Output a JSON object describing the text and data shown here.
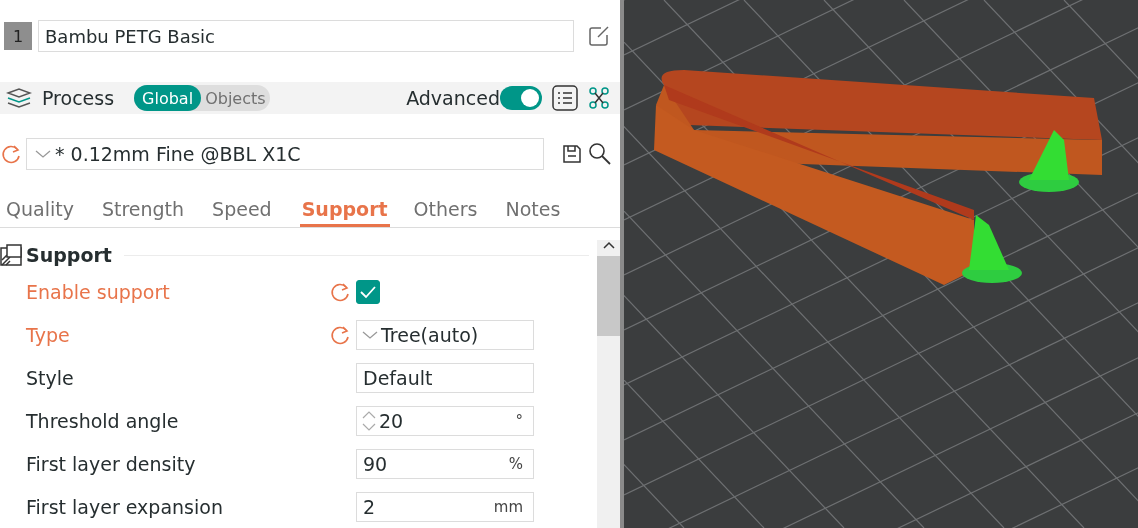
{
  "filament": {
    "index": "1",
    "name": "Bambu PETG Basic"
  },
  "process": {
    "title": "Process",
    "scope": [
      {
        "label": "Global",
        "selected": true
      },
      {
        "label": "Objects",
        "selected": false
      }
    ],
    "advanced": {
      "label": "Advanced",
      "on": true
    }
  },
  "preset": {
    "name": "* 0.12mm Fine @BBL X1C"
  },
  "tabs": [
    {
      "label": "Quality",
      "selected": false
    },
    {
      "label": "Strength",
      "selected": false
    },
    {
      "label": "Speed",
      "selected": false
    },
    {
      "label": "Support",
      "selected": true
    },
    {
      "label": "Others",
      "selected": false
    },
    {
      "label": "Notes",
      "selected": false
    }
  ],
  "section": {
    "title": "Support"
  },
  "settings": [
    {
      "kind": "checkbox",
      "label": "Enable support",
      "modified": true,
      "checked": true
    },
    {
      "kind": "dropdown",
      "label": "Type",
      "modified": true,
      "value": "Tree(auto)"
    },
    {
      "kind": "text",
      "label": "Style",
      "modified": false,
      "value": "Default"
    },
    {
      "kind": "spin",
      "label": "Threshold angle",
      "modified": false,
      "value": "20",
      "unit": "°"
    },
    {
      "kind": "number",
      "label": "First layer density",
      "modified": false,
      "value": "90",
      "unit": "%"
    },
    {
      "kind": "number",
      "label": "First layer expansion",
      "modified": false,
      "value": "2",
      "unit": "mm"
    }
  ]
}
